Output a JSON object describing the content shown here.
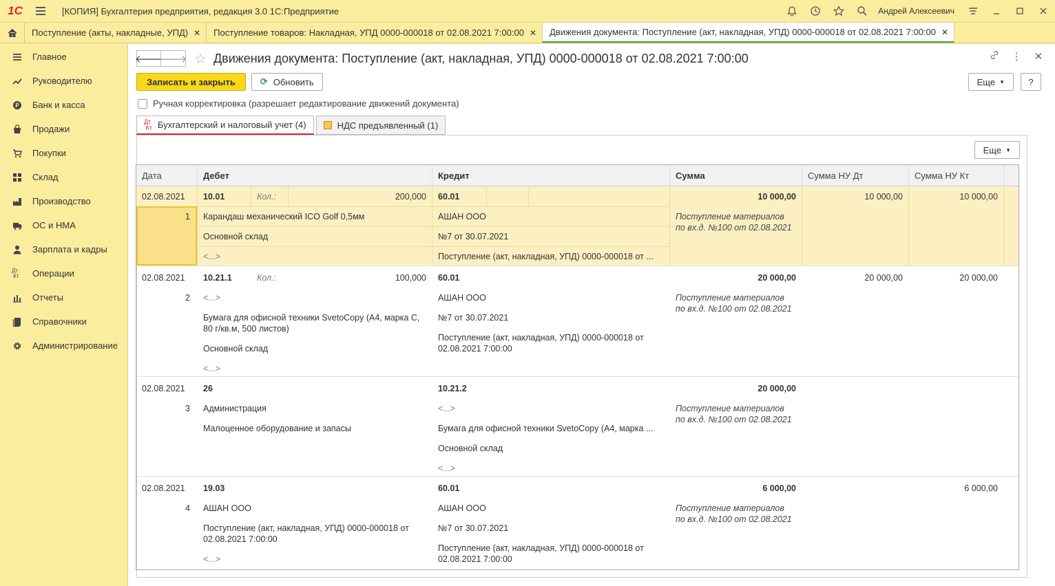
{
  "window": {
    "logo": "1С",
    "title": "[КОПИЯ] Бухгалтерия предприятия, редакция 3.0 1С:Предприятие",
    "user": "Андрей Алексеевич"
  },
  "tabs": [
    {
      "label": "Поступление (акты, накладные, УПД)"
    },
    {
      "label": "Поступление товаров: Накладная, УПД 0000-000018 от 02.08.2021 7:00:00"
    },
    {
      "label": "Движения документа: Поступление (акт, накладная, УПД) 0000-000018 от 02.08.2021 7:00:00"
    }
  ],
  "sidebar": {
    "items": [
      {
        "label": "Главное",
        "icon": "menu-icon"
      },
      {
        "label": "Руководителю",
        "icon": "trend-icon"
      },
      {
        "label": "Банк и касса",
        "icon": "coin-icon"
      },
      {
        "label": "Продажи",
        "icon": "bag-icon"
      },
      {
        "label": "Покупки",
        "icon": "cart-icon"
      },
      {
        "label": "Склад",
        "icon": "warehouse-icon"
      },
      {
        "label": "Производство",
        "icon": "factory-icon"
      },
      {
        "label": "ОС и НМА",
        "icon": "truck-icon"
      },
      {
        "label": "Зарплата и кадры",
        "icon": "person-icon"
      },
      {
        "label": "Операции",
        "icon": "dtkt-icon"
      },
      {
        "label": "Отчеты",
        "icon": "bar-chart-icon"
      },
      {
        "label": "Справочники",
        "icon": "book-icon"
      },
      {
        "label": "Администрирование",
        "icon": "gear-icon"
      }
    ]
  },
  "main": {
    "title": "Движения документа: Поступление (акт, накладная, УПД) 0000-000018 от 02.08.2021 7:00:00",
    "save_close": "Записать и закрыть",
    "refresh": "Обновить",
    "more": "Еще",
    "help": "?",
    "manual_label": "Ручная корректировка (разрешает редактирование движений документа)",
    "form_tabs": [
      {
        "label": "Бухгалтерский и налоговый учет (4)",
        "icon": "Дт\nКт"
      },
      {
        "label": "НДС предъявленный (1)"
      }
    ],
    "panel_more": "Еще"
  },
  "grid": {
    "headers": {
      "date": "Дата",
      "debit": "Дебет",
      "credit": "Кредит",
      "sum": "Сумма",
      "nu_dt": "Сумма НУ Дт",
      "nu_kt": "Сумма НУ Кт"
    },
    "qty_label": "Кол.:",
    "rows": [
      {
        "date": "02.08.2021",
        "num": "1",
        "debit": "10.01",
        "qty": "200,000",
        "debit_sub": [
          "Карандаш механический ICO Golf 0,5мм",
          "Основной склад",
          "<...>"
        ],
        "credit": "60.01",
        "credit_sub": [
          "АШАН ООО",
          "№7 от 30.07.2021",
          "Поступление (акт, накладная, УПД) 0000-000018 от ..."
        ],
        "sum": "10 000,00",
        "content": "Поступление материалов по вх.д. №100 от 02.08.2021",
        "nu_dt": "10 000,00",
        "nu_kt": "10 000,00"
      },
      {
        "date": "02.08.2021",
        "num": "2",
        "debit": "10.21.1",
        "qty": "100,000",
        "debit_sub": [
          "<...>",
          "Бумага для офисной техники SvetoCopy (A4, марка C, 80 г/кв.м, 500 листов)",
          "Основной склад",
          "<...>"
        ],
        "credit": "60.01",
        "credit_sub": [
          "АШАН ООО",
          "№7 от 30.07.2021",
          "Поступление (акт, накладная, УПД) 0000-000018 от 02.08.2021 7:00:00"
        ],
        "sum": "20 000,00",
        "content": "Поступление материалов по вх.д. №100 от 02.08.2021",
        "nu_dt": "20 000,00",
        "nu_kt": "20 000,00"
      },
      {
        "date": "02.08.2021",
        "num": "3",
        "debit": "26",
        "debit_sub": [
          "Администрация",
          "Малоценное оборудование и запасы"
        ],
        "credit": "10.21.2",
        "credit_sub": [
          "<...>",
          "Бумага для офисной техники SvetoCopy (A4, марка ...",
          "Основной склад",
          "<...>"
        ],
        "sum": "20 000,00",
        "content": "Поступление материалов по вх.д. №100 от 02.08.2021",
        "nu_dt": "",
        "nu_kt": ""
      },
      {
        "date": "02.08.2021",
        "num": "4",
        "debit": "19.03",
        "debit_sub": [
          "АШАН ООО",
          "Поступление (акт, накладная, УПД) 0000-000018 от 02.08.2021 7:00:00",
          "<...>"
        ],
        "credit": "60.01",
        "credit_sub": [
          "АШАН ООО",
          "№7 от 30.07.2021",
          "Поступление (акт, накладная, УПД) 0000-000018 от 02.08.2021 7:00:00"
        ],
        "sum": "6 000,00",
        "content": "Поступление материалов по вх.д. №100 от 02.08.2021",
        "nu_dt": "",
        "nu_kt": "6 000,00"
      }
    ]
  },
  "colors": {
    "accent_yellow": "#f8d81a",
    "sidebar_bg": "#fbed9e",
    "logo_red": "#d8262b",
    "active_tab_line": "#3b9d5e"
  }
}
